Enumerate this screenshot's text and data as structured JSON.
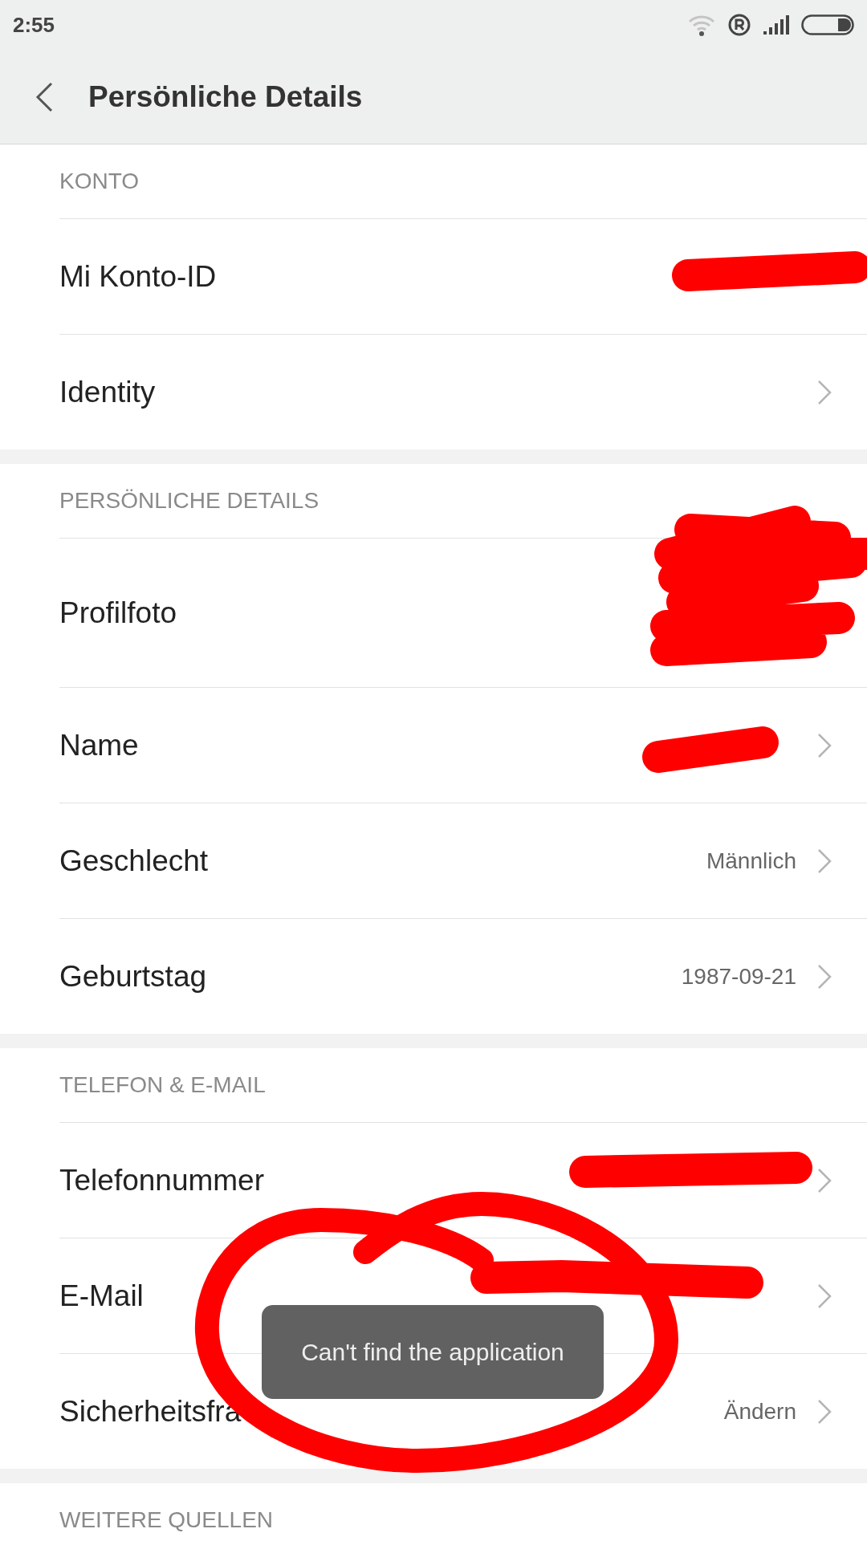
{
  "status_bar": {
    "time": "2:55"
  },
  "header": {
    "title": "Persönliche Details"
  },
  "sections": [
    {
      "title": "KONTO",
      "rows": [
        {
          "kind": "plain",
          "label": "Mi Konto-ID"
        },
        {
          "kind": "link",
          "label": "Identity"
        }
      ]
    },
    {
      "title": "PERSÖNLICHE DETAILS",
      "rows": [
        {
          "kind": "photo",
          "label": "Profilfoto"
        },
        {
          "kind": "link",
          "label": "Name"
        },
        {
          "kind": "link",
          "label": "Geschlecht",
          "value": "Männlich"
        },
        {
          "kind": "link",
          "label": "Geburtstag",
          "value": "1987-09-21"
        }
      ]
    },
    {
      "title": "TELEFON & E-MAIL",
      "rows": [
        {
          "kind": "link",
          "label": "Telefonnummer"
        },
        {
          "kind": "link",
          "label": "E-Mail"
        },
        {
          "kind": "link",
          "label": "Sicherheitsfra",
          "value": "Ändern"
        }
      ]
    },
    {
      "title": "WEITERE QUELLEN"
    }
  ],
  "toast": {
    "text": "Can't find the application"
  }
}
